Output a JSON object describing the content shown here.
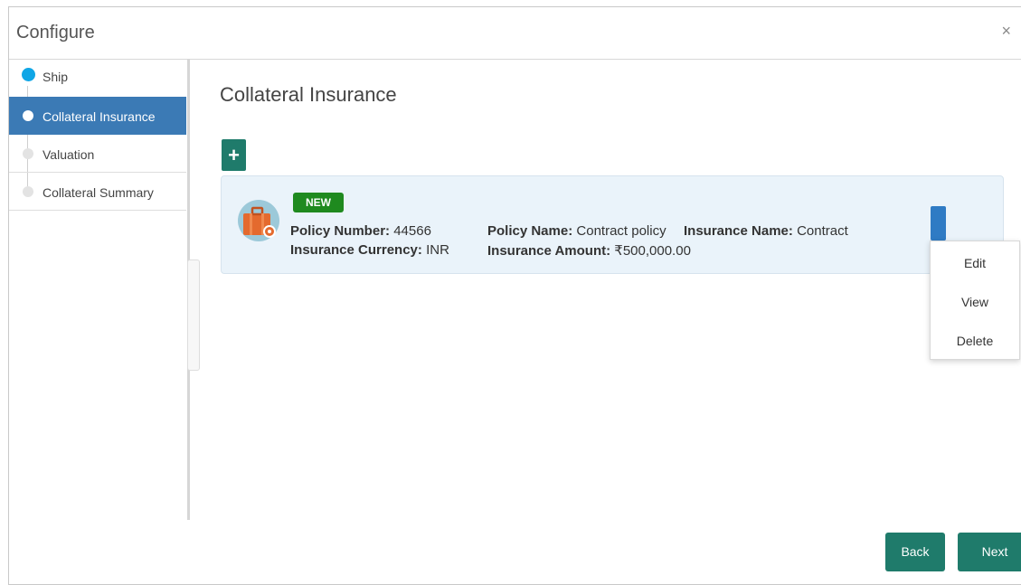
{
  "dialog": {
    "title": "Configure",
    "close_glyph": "×"
  },
  "steps": [
    {
      "label": "Ship",
      "state": "complete"
    },
    {
      "label": "Collateral Insurance",
      "state": "active"
    },
    {
      "label": "Valuation",
      "state": "pending"
    },
    {
      "label": "Collateral Summary",
      "state": "pending"
    }
  ],
  "main": {
    "title": "Collateral Insurance",
    "add_glyph": "+"
  },
  "policy_card": {
    "badge": "NEW",
    "policy_number_label": "Policy Number:",
    "policy_number": "44566",
    "insurance_currency_label": "Insurance Currency:",
    "insurance_currency": "INR",
    "policy_name_label": "Policy Name:",
    "policy_name": "Contract policy",
    "insurance_amount_label": "Insurance Amount:",
    "insurance_amount": "₹500,000.00",
    "insurance_name_label": "Insurance Name:",
    "insurance_name": "Contract"
  },
  "context_menu": {
    "items": [
      "Edit",
      "View",
      "Delete"
    ]
  },
  "footer": {
    "back_label": "Back",
    "next_label": "Next"
  },
  "colors": {
    "accent": "#1f7b6b",
    "active_step": "#3b7ab5",
    "badge": "#1f8a1f",
    "kebab": "#2f7bc4"
  }
}
